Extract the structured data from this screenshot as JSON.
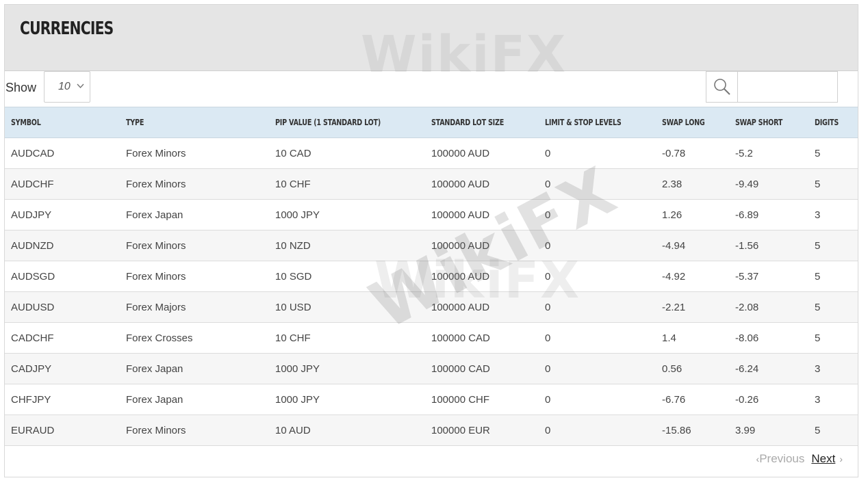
{
  "page": {
    "title": "CURRENCIES"
  },
  "controls": {
    "show_label": "Show",
    "page_length": "10",
    "search_placeholder": ""
  },
  "table": {
    "columns": [
      "SYMBOL",
      "TYPE",
      "PIP VALUE (1 STANDARD LOT)",
      "STANDARD LOT SIZE",
      "LIMIT & STOP LEVELS",
      "SWAP LONG",
      "SWAP SHORT",
      "DIGITS"
    ],
    "rows": [
      [
        "AUDCAD",
        "Forex Minors",
        "10 CAD",
        "100000 AUD",
        "0",
        "-0.78",
        "-5.2",
        "5"
      ],
      [
        "AUDCHF",
        "Forex Minors",
        "10 CHF",
        "100000 AUD",
        "0",
        "2.38",
        "-9.49",
        "5"
      ],
      [
        "AUDJPY",
        "Forex Japan",
        "1000 JPY",
        "100000 AUD",
        "0",
        "1.26",
        "-6.89",
        "3"
      ],
      [
        "AUDNZD",
        "Forex Minors",
        "10 NZD",
        "100000 AUD",
        "0",
        "-4.94",
        "-1.56",
        "5"
      ],
      [
        "AUDSGD",
        "Forex Minors",
        "10 SGD",
        "100000 AUD",
        "0",
        "-4.92",
        "-5.37",
        "5"
      ],
      [
        "AUDUSD",
        "Forex Majors",
        "10 USD",
        "100000 AUD",
        "0",
        "-2.21",
        "-2.08",
        "5"
      ],
      [
        "CADCHF",
        "Forex Crosses",
        "10 CHF",
        "100000 CAD",
        "0",
        "1.4",
        "-8.06",
        "5"
      ],
      [
        "CADJPY",
        "Forex Japan",
        "1000 JPY",
        "100000 CAD",
        "0",
        "0.56",
        "-6.24",
        "3"
      ],
      [
        "CHFJPY",
        "Forex Japan",
        "1000 JPY",
        "100000 CHF",
        "0",
        "-6.76",
        "-0.26",
        "3"
      ],
      [
        "EURAUD",
        "Forex Minors",
        "10 AUD",
        "100000 EUR",
        "0",
        "-15.86",
        "3.99",
        "5"
      ]
    ]
  },
  "pager": {
    "previous": "Previous",
    "next": "Next"
  },
  "watermark": {
    "text": "WikiFX"
  },
  "icons": {
    "search": "search-icon",
    "dropdown": "chevron-down-icon",
    "prev": "chevron-left-icon",
    "next": "chevron-right-icon"
  }
}
